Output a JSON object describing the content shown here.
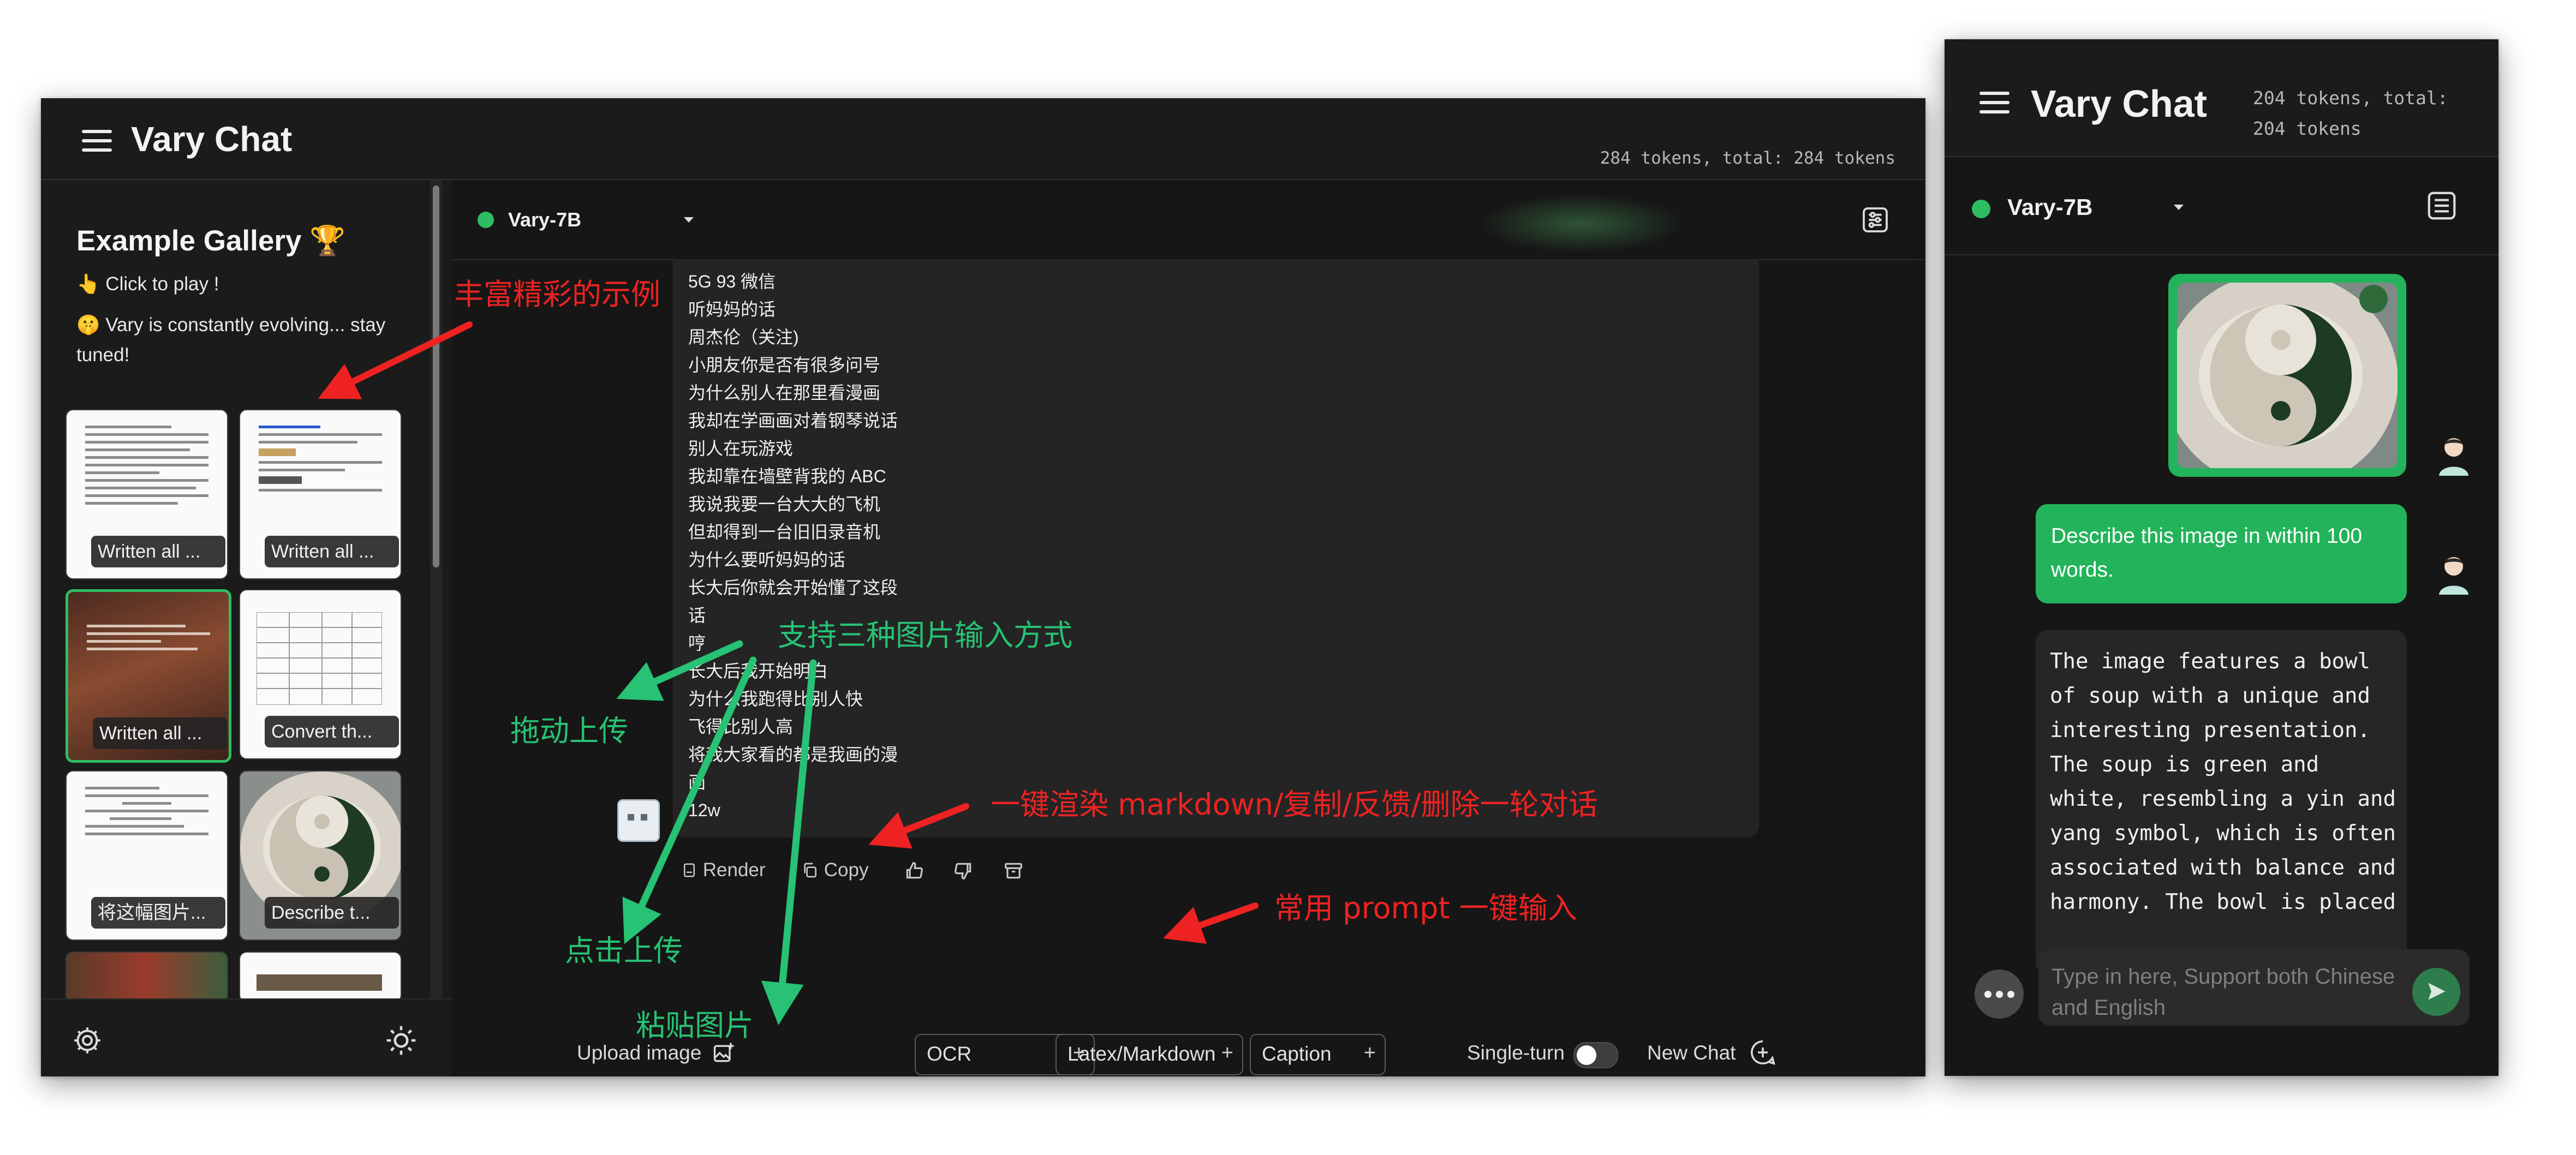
{
  "desktop": {
    "app_title": "Vary Chat",
    "token_info": "284 tokens, total: 284 tokens",
    "gallery": {
      "title": "Example Gallery 🏆",
      "line1": "👆 Click to play !",
      "line2": "🤫 Vary is constantly evolving... stay tuned!",
      "cards": [
        {
          "caption": "Written all ..."
        },
        {
          "caption": "Written all ..."
        },
        {
          "caption": "Written all ..."
        },
        {
          "caption": "Convert th..."
        },
        {
          "caption": "将这幅图片..."
        },
        {
          "caption": "Describe t..."
        }
      ]
    },
    "model": "Vary-7B",
    "message_lines": [
      "5G 93 微信",
      "听妈妈的话",
      "周杰伦（关注)",
      "小朋友你是否有很多问号",
      "为什么别人在那里看漫画",
      "我却在学画画对着钢琴说话",
      "别人在玩游戏",
      "我却靠在墙壁背我的 ABC",
      "我说我要一台大大的飞机",
      "但却得到一台旧旧录音机",
      "为什么要听妈妈的话",
      "长大后你就会开始懂了这段",
      "话",
      "哼",
      "长大后我开始明白",
      "为什么我跑得比别人快",
      "飞得比别人高",
      "将我大家看的都是我画的漫",
      "画",
      "12w"
    ],
    "actions": {
      "render": "Render",
      "copy": "Copy"
    },
    "upload_label": "Upload image",
    "chips": [
      "OCR",
      "Latex/Markdown",
      "Caption"
    ],
    "single_turn_label": "Single-turn",
    "new_chat_label": "New Chat",
    "input_placeholder": "Type in here, Support both Chinese and English"
  },
  "mobile": {
    "app_title": "Vary Chat",
    "token_info": "204 tokens, total: 204 tokens",
    "model": "Vary-7B",
    "user_message": "Describe this image in within 100 words.",
    "bot_message": "The image features a bowl of soup with a unique and interesting presentation. The soup is green and white, resembling a yin and yang symbol, which is often associated with balance and harmony. The bowl is placed",
    "input_placeholder": "Type in here, Support both Chinese and English"
  },
  "annotations": {
    "examples": "丰富精彩的示例",
    "three_ways": "支持三种图片输入方式",
    "drag_upload": "拖动上传",
    "click_upload": "点击上传",
    "paste_image": "粘贴图片",
    "one_click_actions": "一键渲染 markdown/复制/反馈/删除一轮对话",
    "common_prompt": "常用 prompt 一键输入"
  },
  "colors": {
    "accent_green": "#23b35a",
    "annotation_red": "#ee2222",
    "annotation_green": "#27c274",
    "background": "#181818"
  }
}
